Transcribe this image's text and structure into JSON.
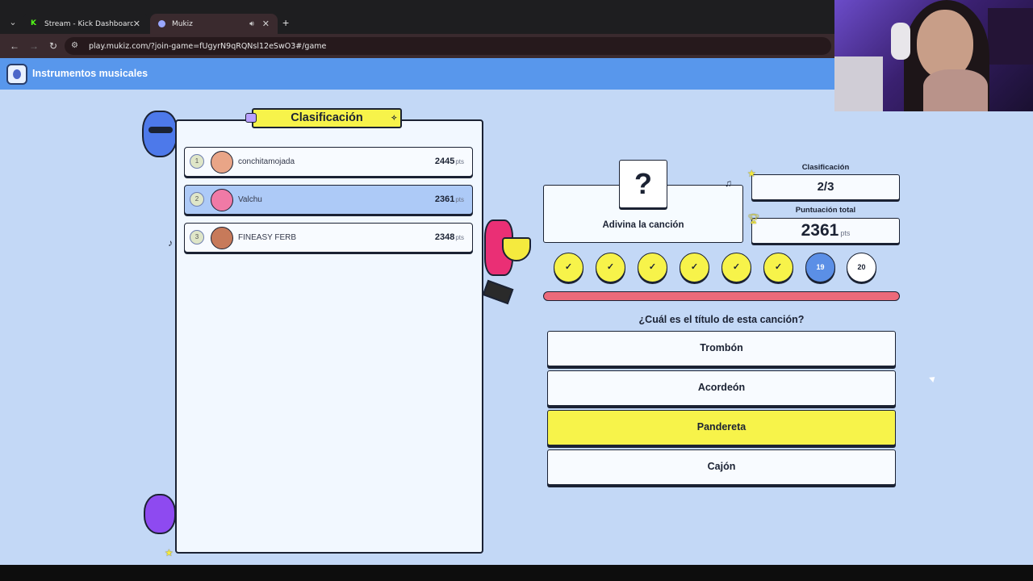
{
  "browser": {
    "tabs": [
      {
        "label": "Stream - Kick Dashboard",
        "icon": "kick-icon",
        "active": false
      },
      {
        "label": "Mukiz",
        "icon": "mukiz-icon",
        "active": true
      }
    ],
    "url": "play.mukiz.com/?join-game=fUgyrN9qRQNsl12eSwO3#/game"
  },
  "header": {
    "title": "Instrumentos musicales"
  },
  "leaderboard": {
    "title": "Clasificación",
    "players": [
      {
        "rank": "1",
        "name": "conchitamojada",
        "points": "2445",
        "unit": "pts",
        "avatar_color": "#e9a587"
      },
      {
        "rank": "2",
        "name": "Valchu",
        "points": "2361",
        "unit": "pts",
        "avatar_color": "#f07aa6"
      },
      {
        "rank": "3",
        "name": "FINEASY FERB",
        "points": "2348",
        "unit": "pts",
        "avatar_color": "#c77a5a"
      }
    ]
  },
  "question": {
    "icon": "?",
    "label": "Adivina la canción",
    "prompt": "¿Cuál es el título de esta canción?"
  },
  "stats": {
    "rank_label": "Clasificación",
    "rank_value": "2/3",
    "score_label": "Puntuación total",
    "score_value": "2361",
    "score_unit": "pts"
  },
  "progress": {
    "steps": [
      {
        "state": "done",
        "text": "✓"
      },
      {
        "state": "done",
        "text": "✓"
      },
      {
        "state": "done",
        "text": "✓"
      },
      {
        "state": "done",
        "text": "✓"
      },
      {
        "state": "done",
        "text": "✓"
      },
      {
        "state": "done",
        "text": "✓"
      },
      {
        "state": "current",
        "text": "19"
      },
      {
        "state": "todo",
        "text": "20"
      }
    ]
  },
  "answers": [
    {
      "label": "Trombón",
      "selected": false
    },
    {
      "label": "Acordeón",
      "selected": false
    },
    {
      "label": "Pandereta",
      "selected": true
    },
    {
      "label": "Cajón",
      "selected": false
    }
  ],
  "colors": {
    "page_bg": "#c3d8f6",
    "header_bg": "#5897ec",
    "accent_yellow": "#f7f34a",
    "timer": "#ec6a7a",
    "current_step": "#5b8fe6"
  }
}
